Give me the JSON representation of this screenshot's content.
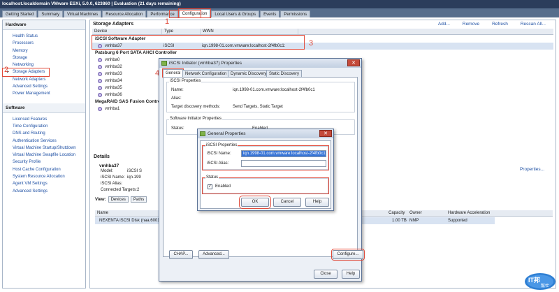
{
  "window": {
    "title": "localhost.localdomain VMware ESXi, 5.0.0, 623860  |  Evaluation (21 days remaining)"
  },
  "tabs": [
    "Getting Started",
    "Summary",
    "Virtual Machines",
    "Resource Allocation",
    "Performance",
    "Configuration",
    "Local Users & Groups",
    "Events",
    "Permissions"
  ],
  "active_tab": "Configuration",
  "nav": {
    "hardware_title": "Hardware",
    "hardware_items": [
      "Health Status",
      "Processors",
      "Memory",
      "Storage",
      "Networking",
      "Storage Adapters",
      "Network Adapters",
      "Advanced Settings",
      "Power Management"
    ],
    "software_title": "Software",
    "software_items": [
      "Licensed Features",
      "Time Configuration",
      "DNS and Routing",
      "Authentication Services",
      "Virtual Machine Startup/Shutdown",
      "Virtual Machine Swapfile Location",
      "Security Profile",
      "Host Cache Configuration",
      "System Resource Allocation",
      "Agent VM Settings",
      "Advanced Settings"
    ]
  },
  "storage": {
    "title": "Storage Adapters",
    "toolbar": {
      "add": "Add...",
      "remove": "Remove",
      "refresh": "Refresh",
      "rescan": "Rescan All..."
    },
    "columns": {
      "device": "Device",
      "type": "Type",
      "wwn": "WWN"
    },
    "group1": "iSCSI Software Adapter",
    "iscsi_row": {
      "device": "vmhba37",
      "type": "iSCSI",
      "wwn": "iqn.1998-01.com.vmware:localhost-2f4fb0c1:"
    },
    "group2": "Patsburg 6 Port SATA AHCI Controller",
    "sata_devices": [
      "vmhba0",
      "vmhba32",
      "vmhba33",
      "vmhba34",
      "vmhba35",
      "vmhba36"
    ],
    "group3": "MegaRAID SAS Fusion Contro",
    "mega_devices": [
      "vmhba1"
    ]
  },
  "details": {
    "title": "Details",
    "adapter": "vmhba37",
    "model_label": "Model:",
    "model_value": "iSCSI S",
    "iscsi_name_label": "iSCSI Name:",
    "iscsi_name_value": "iqn.199",
    "alias_label": "iSCSI Alias:",
    "targets_label": "Connected Targets:",
    "targets_value": "2",
    "properties_link": "Properties...",
    "view_label": "View:",
    "view_devices": "Devices",
    "view_paths": "Paths",
    "grid_name_col": "Name",
    "grid_capacity_col": "Capacity",
    "grid_owner_col": "Owner",
    "grid_hw_col": "Hardware Acceleration",
    "row_name": "NEXENTA iSCSI Disk (naa.6001",
    "row_capacity": "1.00 TB",
    "row_owner": "NMP",
    "row_hw": "Supported"
  },
  "dialog1": {
    "title": "iSCSI Initiator (vmhba37) Properties",
    "tabs": [
      "General",
      "Network Configuration",
      "Dynamic Discovery",
      "Static Discovery"
    ],
    "iscsi_props_title": "iSCSI Properties",
    "name_label": "Name:",
    "name_value": "iqn.1998-01.com.vmware:localhost-2f4fb0c1",
    "alias_label": "Alias:",
    "target_label": "Target discovery methods:",
    "target_value": "Send Targets, Static Target",
    "sw_props_title": "Software Initiator Properties",
    "status_label": "Status:",
    "status_value": "Enabled",
    "chap": "CHAP...",
    "advanced": "Advanced...",
    "configure": "Configure...",
    "close": "Close",
    "help": "Help"
  },
  "dialog2": {
    "title": "General Properties",
    "iscsi_props_title": "iSCSI Properties",
    "iscsi_name_label": "iSCSI Name:",
    "iscsi_name_value": "iqn.1998-01.com.vmware:localhost-2f4fb0c1",
    "iscsi_alias_label": "iSCSI Alias:",
    "status_title": "Status",
    "enabled_label": "Enabled",
    "ok": "OK",
    "cancel": "Cancel",
    "help": "Help"
  },
  "callouts": [
    "1",
    "2",
    "3",
    "4",
    "5",
    "6",
    "7",
    "8"
  ],
  "watermark": {
    "text": "IT邦",
    "subtext": "幫忙"
  },
  "colors": {
    "callout": "#e04a3a",
    "link": "#1d4fa3",
    "titlebar": "#2b3d5c"
  }
}
